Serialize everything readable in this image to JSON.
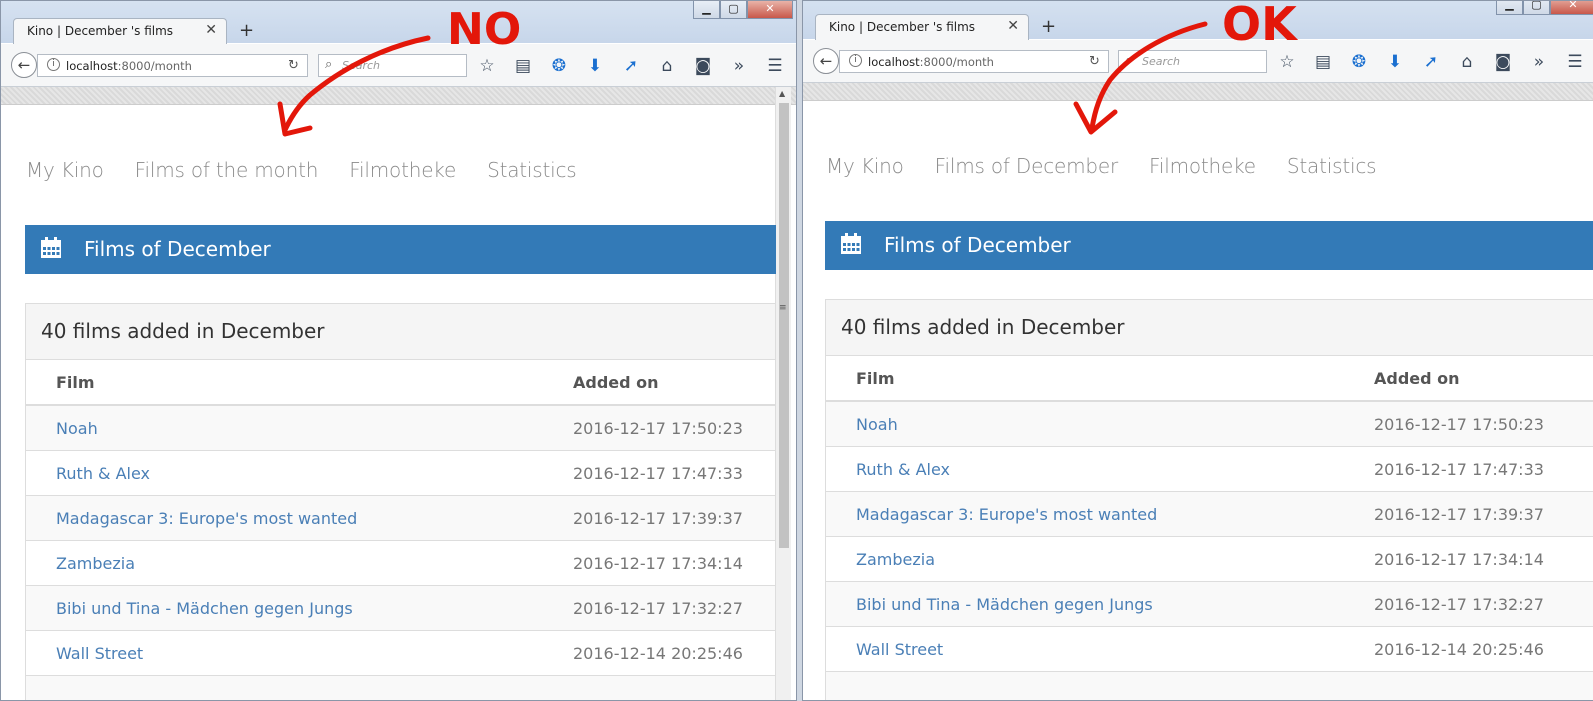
{
  "annotations": {
    "left_label": "NO",
    "right_label": "OK",
    "color": "#e3170a"
  },
  "left": {
    "tab_title": "Kino | December 's films",
    "url_host": "localhost",
    "url_rest": ":8000/month",
    "search_placeholder": "Search",
    "nav": [
      "My Kino",
      "Films of the month",
      "Filmotheke",
      "Statistics"
    ],
    "panel_title": "Films of December",
    "count_text": "40 films added in December",
    "col_film": "Film",
    "col_added": "Added on",
    "rows": [
      {
        "film": "Noah",
        "added": "2016-12-17 17:50:23"
      },
      {
        "film": "Ruth & Alex",
        "added": "2016-12-17 17:47:33"
      },
      {
        "film": "Madagascar 3: Europe's most wanted",
        "added": "2016-12-17 17:39:37"
      },
      {
        "film": "Zambezia",
        "added": "2016-12-17 17:34:14"
      },
      {
        "film": "Bibi und Tina - Mädchen gegen Jungs",
        "added": "2016-12-17 17:32:27"
      },
      {
        "film": "Wall Street",
        "added": "2016-12-14 20:25:46"
      }
    ]
  },
  "right": {
    "tab_title": "Kino | December 's films",
    "url_host": "localhost",
    "url_rest": ":8000/month",
    "search_placeholder": "Search",
    "nav": [
      "My Kino",
      "Films of December",
      "Filmotheke",
      "Statistics"
    ],
    "panel_title": "Films of December",
    "count_text": "40 films added in December",
    "col_film": "Film",
    "col_added": "Added on",
    "rows": [
      {
        "film": "Noah",
        "added": "2016-12-17 17:50:23"
      },
      {
        "film": "Ruth & Alex",
        "added": "2016-12-17 17:47:33"
      },
      {
        "film": "Madagascar 3: Europe's most wanted",
        "added": "2016-12-17 17:39:37"
      },
      {
        "film": "Zambezia",
        "added": "2016-12-17 17:34:14"
      },
      {
        "film": "Bibi und Tina - Mädchen gegen Jungs",
        "added": "2016-12-17 17:32:27"
      },
      {
        "film": "Wall Street",
        "added": "2016-12-14 20:25:46"
      }
    ]
  },
  "icons": {
    "back": "back-arrow-icon",
    "info": "info-icon",
    "reload": "reload-icon",
    "search": "search-icon",
    "toolbar": [
      "bookmark-star-icon",
      "reading-list-icon",
      "extension-swirl-icon",
      "download-icon",
      "extension-cursor-icon",
      "home-icon",
      "pocket-icon",
      "overflow-chevron-icon",
      "menu-icon"
    ],
    "calendar": "calendar-icon"
  },
  "colors": {
    "panel_bg": "#337ab7",
    "link": "#4a7fb6",
    "nav_text": "#8a8a8a"
  }
}
